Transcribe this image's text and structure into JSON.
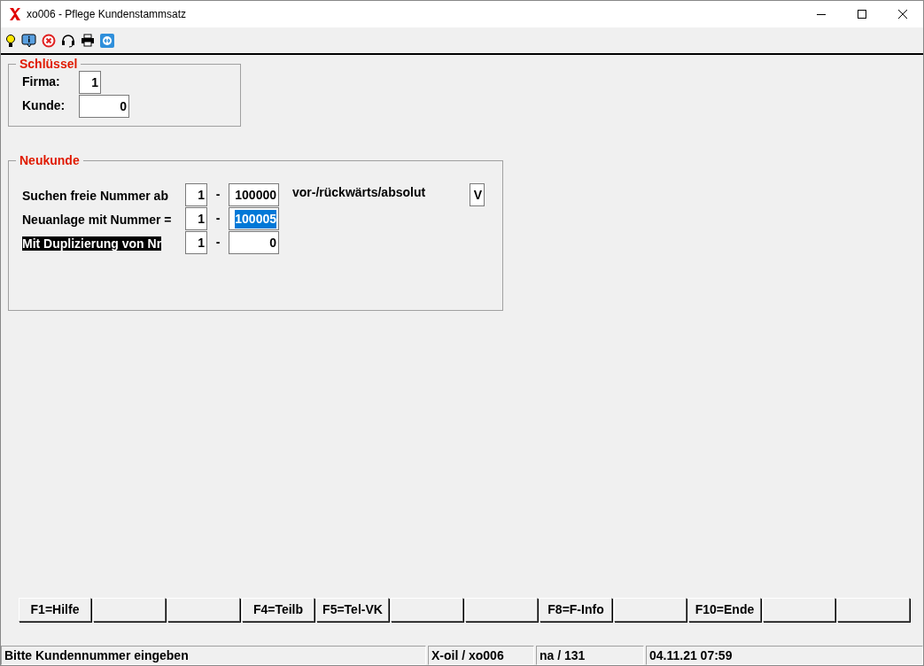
{
  "window": {
    "title": "xo006 - Pflege Kundenstammsatz"
  },
  "key_group": {
    "title": "Schlüssel",
    "fields": [
      {
        "label": "Firma:",
        "value": "1"
      },
      {
        "label": "Kunde:",
        "value": "0"
      }
    ]
  },
  "new_customer_group": {
    "title": "Neukunde",
    "rows": [
      {
        "label": "Suchen freie Nummer ab",
        "highlighted": false,
        "firm": "1",
        "separator": "-",
        "number": "100000",
        "selected": false,
        "extra_label": "vor-/rückwärts/absolut",
        "extra_value": "V"
      },
      {
        "label": "Neuanlage mit Nummer =",
        "highlighted": false,
        "firm": "1",
        "separator": "-",
        "number": "100005",
        "selected": true
      },
      {
        "label": "Mit Duplizierung von Nr",
        "highlighted": true,
        "firm": "1",
        "separator": "-",
        "number": "0",
        "selected": false
      }
    ]
  },
  "function_keys": [
    {
      "kind": "key",
      "label": "F1=Hilfe"
    },
    {
      "kind": "blank"
    },
    {
      "kind": "blank"
    },
    {
      "kind": "key",
      "label": "F4=Teilb"
    },
    {
      "kind": "key",
      "label": "F5=Tel-VK"
    },
    {
      "kind": "blank"
    },
    {
      "kind": "blank"
    },
    {
      "kind": "key",
      "label": "F8=F-Info"
    },
    {
      "kind": "blank"
    },
    {
      "kind": "key",
      "label": "F10=Ende"
    },
    {
      "kind": "blank"
    },
    {
      "kind": "blank"
    }
  ],
  "status_bar": [
    "Bitte Kundennummer eingeben",
    "X-oil / xo006",
    "na / 131",
    "04.11.21 07:59"
  ]
}
